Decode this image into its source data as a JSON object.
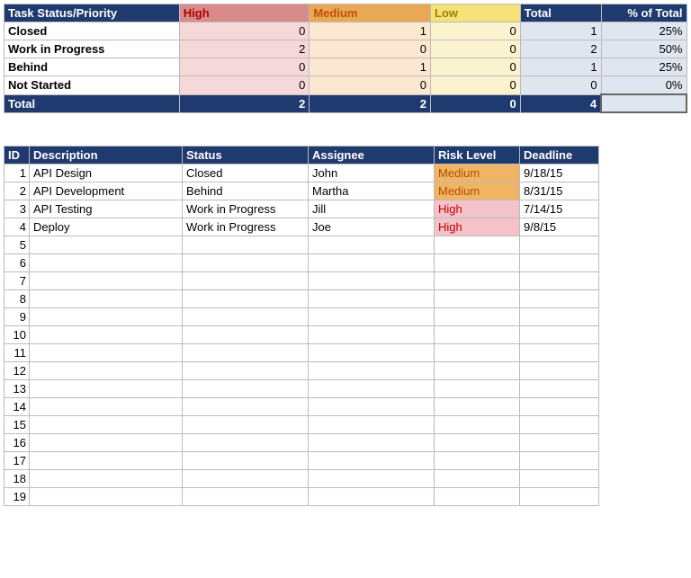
{
  "summary": {
    "header": {
      "label": "Task Status/Priority",
      "high": "High",
      "medium": "Medium",
      "low": "Low",
      "total": "Total",
      "pct": "% of Total"
    },
    "rows": [
      {
        "label": "Closed",
        "high": "0",
        "med": "1",
        "low": "0",
        "total": "1",
        "pct": "25%"
      },
      {
        "label": "Work in Progress",
        "high": "2",
        "med": "0",
        "low": "0",
        "total": "2",
        "pct": "50%"
      },
      {
        "label": "Behind",
        "high": "0",
        "med": "1",
        "low": "0",
        "total": "1",
        "pct": "25%"
      },
      {
        "label": "Not Started",
        "high": "0",
        "med": "0",
        "low": "0",
        "total": "0",
        "pct": "0%"
      }
    ],
    "totals": {
      "label": "Total",
      "high": "2",
      "med": "2",
      "low": "0",
      "total": "4",
      "pct": ""
    }
  },
  "tasks": {
    "header": {
      "id": "ID",
      "desc": "Description",
      "status": "Status",
      "assignee": "Assignee",
      "risk": "Risk Level",
      "deadline": "Deadline"
    },
    "rows": [
      {
        "id": "1",
        "desc": "API Design",
        "status": "Closed",
        "assignee": "John",
        "risk": "Medium",
        "deadline": "9/18/15"
      },
      {
        "id": "2",
        "desc": "API Development",
        "status": "Behind",
        "assignee": "Martha",
        "risk": "Medium",
        "deadline": "8/31/15"
      },
      {
        "id": "3",
        "desc": "API Testing",
        "status": "Work in Progress",
        "assignee": "Jill",
        "risk": "High",
        "deadline": "7/14/15"
      },
      {
        "id": "4",
        "desc": "Deploy",
        "status": "Work in Progress",
        "assignee": "Joe",
        "risk": "High",
        "deadline": "9/8/15"
      },
      {
        "id": "5",
        "desc": "",
        "status": "",
        "assignee": "",
        "risk": "",
        "deadline": ""
      },
      {
        "id": "6",
        "desc": "",
        "status": "",
        "assignee": "",
        "risk": "",
        "deadline": ""
      },
      {
        "id": "7",
        "desc": "",
        "status": "",
        "assignee": "",
        "risk": "",
        "deadline": ""
      },
      {
        "id": "8",
        "desc": "",
        "status": "",
        "assignee": "",
        "risk": "",
        "deadline": ""
      },
      {
        "id": "9",
        "desc": "",
        "status": "",
        "assignee": "",
        "risk": "",
        "deadline": ""
      },
      {
        "id": "10",
        "desc": "",
        "status": "",
        "assignee": "",
        "risk": "",
        "deadline": ""
      },
      {
        "id": "11",
        "desc": "",
        "status": "",
        "assignee": "",
        "risk": "",
        "deadline": ""
      },
      {
        "id": "12",
        "desc": "",
        "status": "",
        "assignee": "",
        "risk": "",
        "deadline": ""
      },
      {
        "id": "13",
        "desc": "",
        "status": "",
        "assignee": "",
        "risk": "",
        "deadline": ""
      },
      {
        "id": "14",
        "desc": "",
        "status": "",
        "assignee": "",
        "risk": "",
        "deadline": ""
      },
      {
        "id": "15",
        "desc": "",
        "status": "",
        "assignee": "",
        "risk": "",
        "deadline": ""
      },
      {
        "id": "16",
        "desc": "",
        "status": "",
        "assignee": "",
        "risk": "",
        "deadline": ""
      },
      {
        "id": "17",
        "desc": "",
        "status": "",
        "assignee": "",
        "risk": "",
        "deadline": ""
      },
      {
        "id": "18",
        "desc": "",
        "status": "",
        "assignee": "",
        "risk": "",
        "deadline": ""
      },
      {
        "id": "19",
        "desc": "",
        "status": "",
        "assignee": "",
        "risk": "",
        "deadline": ""
      }
    ]
  },
  "chart_data": {
    "type": "table",
    "title": "Task Status/Priority",
    "categories": [
      "High",
      "Medium",
      "Low"
    ],
    "series": [
      {
        "name": "Closed",
        "values": [
          0,
          1,
          0
        ]
      },
      {
        "name": "Work in Progress",
        "values": [
          2,
          0,
          0
        ]
      },
      {
        "name": "Behind",
        "values": [
          0,
          1,
          0
        ]
      },
      {
        "name": "Not Started",
        "values": [
          0,
          0,
          0
        ]
      }
    ],
    "totals": {
      "High": 2,
      "Medium": 2,
      "Low": 0,
      "All": 4
    },
    "pct_of_total": {
      "Closed": 25,
      "Work in Progress": 50,
      "Behind": 25,
      "Not Started": 0
    }
  }
}
